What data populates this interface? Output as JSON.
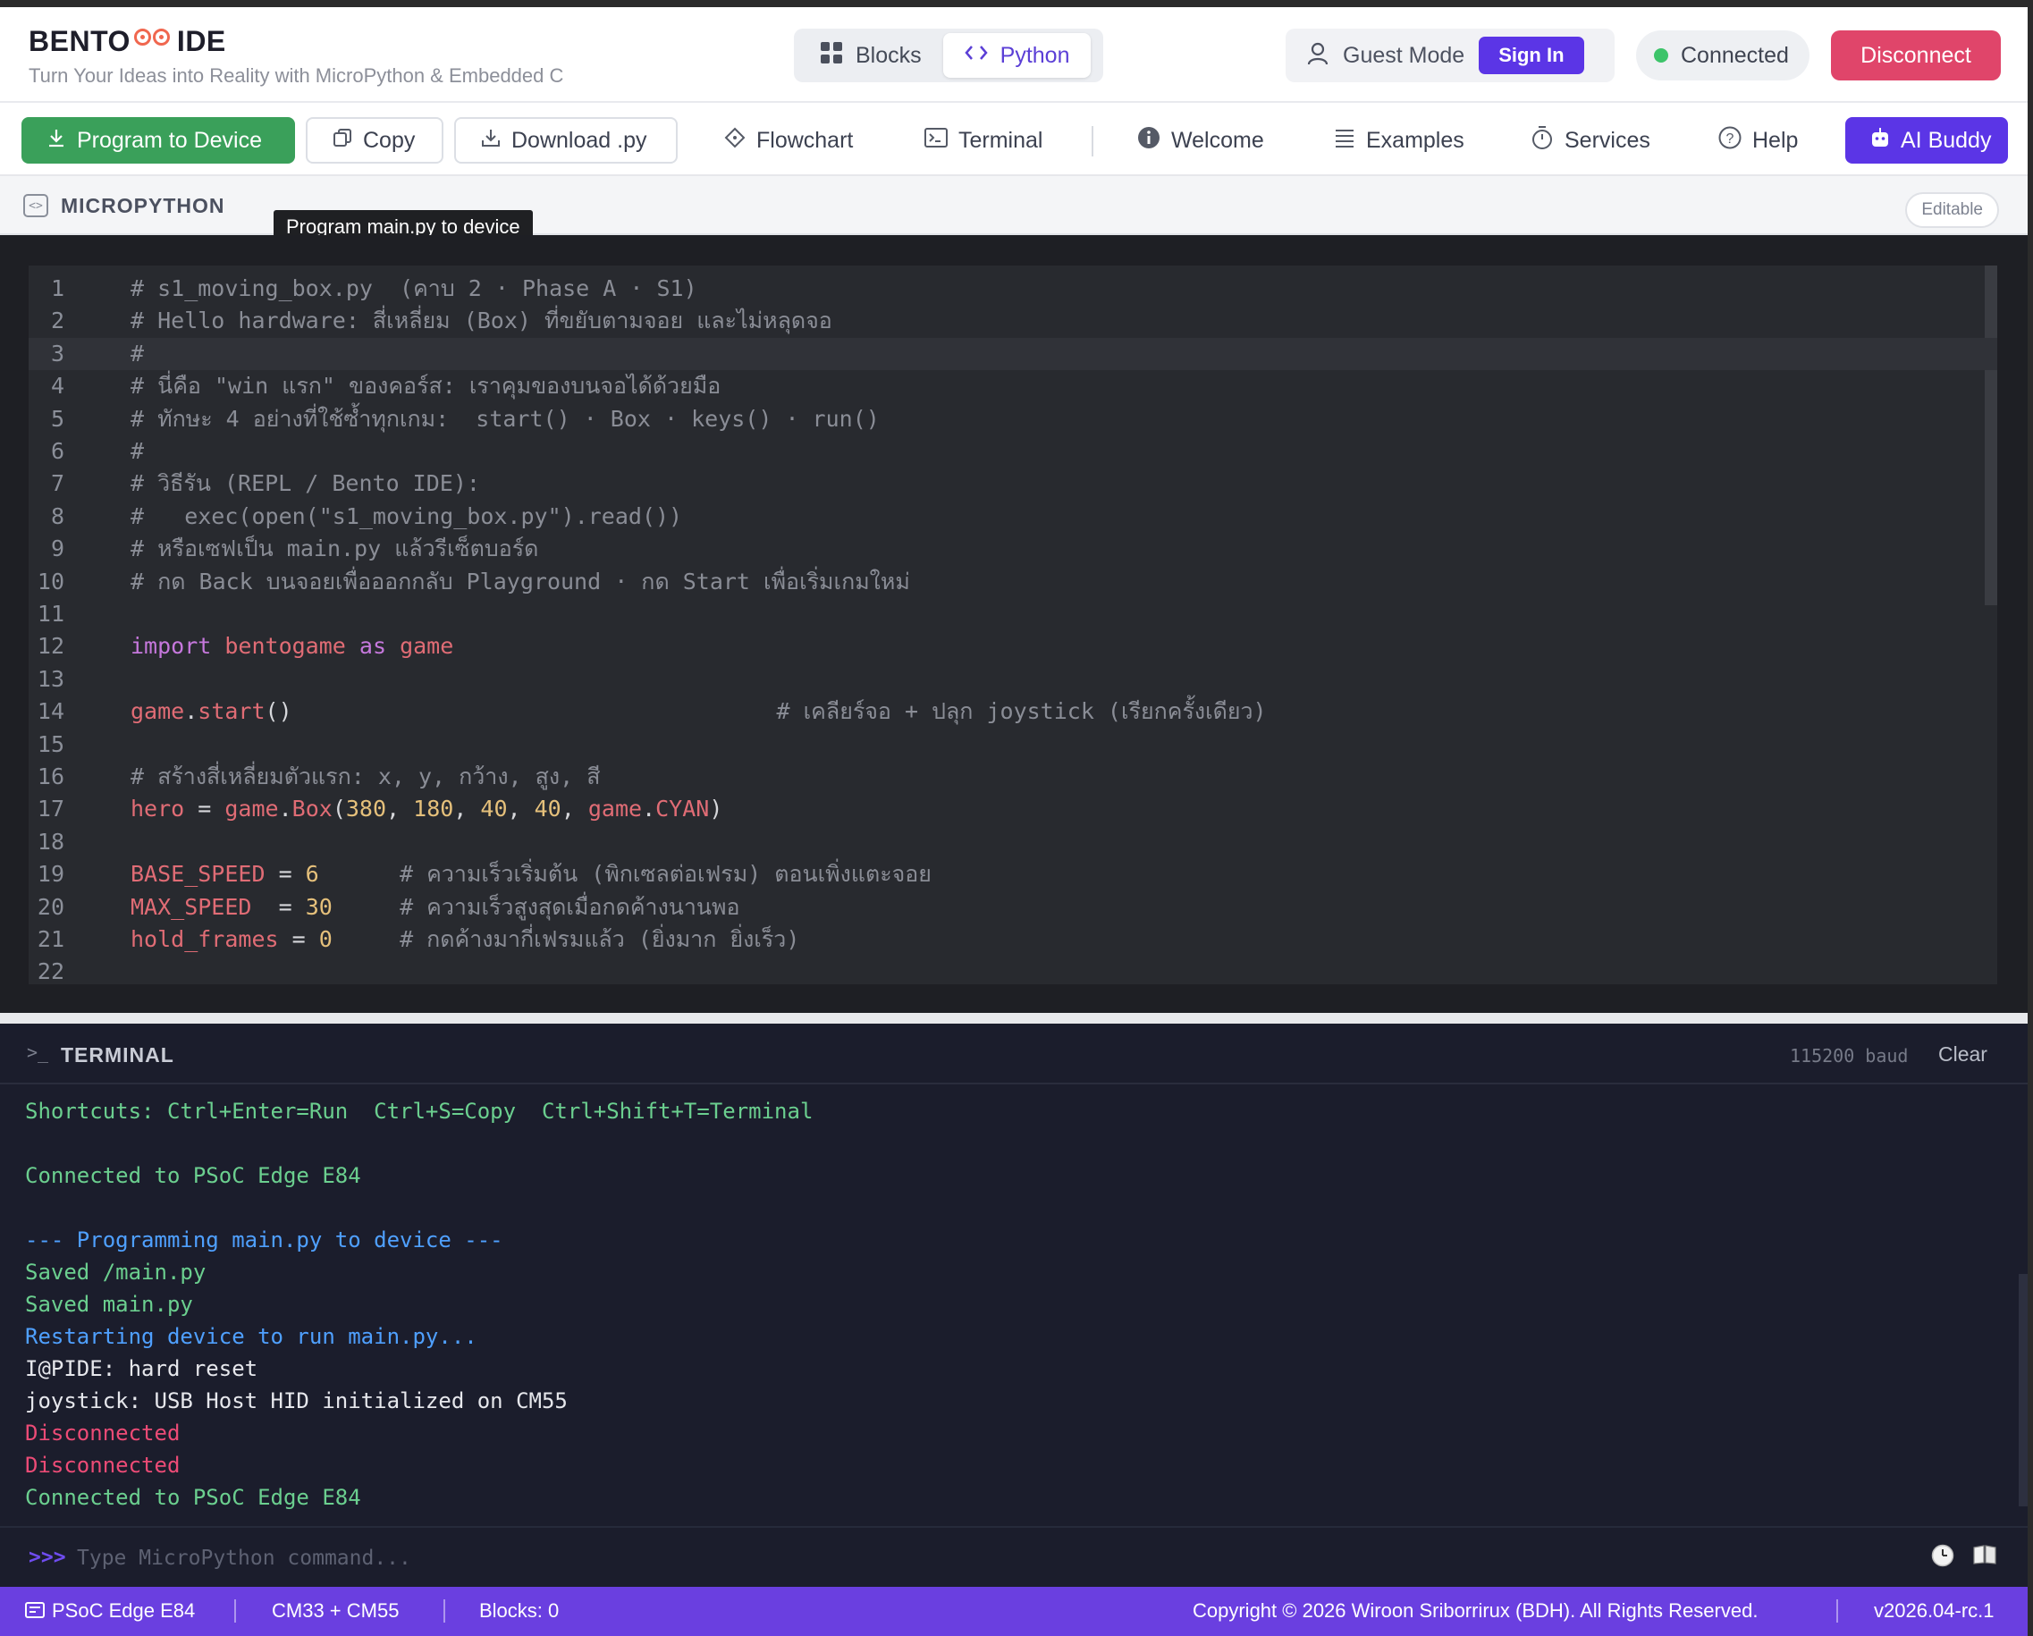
{
  "header": {
    "brand_title_a": "BENTO",
    "brand_title_b": "IDE",
    "brand_subtitle": "Turn Your Ideas into Reality with MicroPython & Embedded C",
    "mode_tabs": [
      {
        "label": "Blocks",
        "icon": "grid-icon"
      },
      {
        "label": "Python",
        "icon": "code-icon",
        "active": true
      }
    ],
    "guest_label": "Guest Mode",
    "signin_label": "Sign In",
    "connection_status": "Connected",
    "disconnect_label": "Disconnect",
    "colors": {
      "accent": "#5b35e6",
      "connected": "#3dc46a",
      "disconnect": "#e0456a",
      "program": "#3aa05a"
    }
  },
  "toolbar": {
    "program_label": "Program to Device",
    "copy_label": "Copy",
    "download_label": "Download .py",
    "flowchart_label": "Flowchart",
    "terminal_label": "Terminal",
    "welcome_label": "Welcome",
    "examples_label": "Examples",
    "services_label": "Services",
    "help_label": "Help",
    "ai_label": "AI Buddy"
  },
  "editor": {
    "title": "MICROPYTHON",
    "tooltip": "Program main.py to device",
    "editable_label": "Editable",
    "active_line": 3,
    "lines": [
      {
        "no": "1",
        "parts": [
          [
            "c",
            "# s1_moving_box.py  (คาบ 2 · Phase A · S1)"
          ]
        ]
      },
      {
        "no": "2",
        "parts": [
          [
            "c",
            "# Hello hardware: สี่เหลี่ยม (Box) ที่ขยับตามจอย และไม่หลุดจอ"
          ]
        ]
      },
      {
        "no": "3",
        "parts": [
          [
            "c",
            "#"
          ]
        ]
      },
      {
        "no": "4",
        "parts": [
          [
            "c",
            "# นี่คือ \"win แรก\" ของคอร์ส: เราคุมของบนจอได้ด้วยมือ"
          ]
        ]
      },
      {
        "no": "5",
        "parts": [
          [
            "c",
            "# ทักษะ 4 อย่างที่ใช้ซ้ำทุกเกม:  start() · Box · keys() · run()"
          ]
        ]
      },
      {
        "no": "6",
        "parts": [
          [
            "c",
            "#"
          ]
        ]
      },
      {
        "no": "7",
        "parts": [
          [
            "c",
            "# วิธีรัน (REPL / Bento IDE):"
          ]
        ]
      },
      {
        "no": "8",
        "parts": [
          [
            "c",
            "#   exec(open(\"s1_moving_box.py\").read())"
          ]
        ]
      },
      {
        "no": "9",
        "parts": [
          [
            "c",
            "# หรือเซฟเป็น main.py แล้วรีเซ็ตบอร์ด"
          ]
        ]
      },
      {
        "no": "10",
        "parts": [
          [
            "c",
            "# กด Back บนจอยเพื่อออกกลับ Playground · กด Start เพื่อเริ่มเกมใหม่"
          ]
        ]
      },
      {
        "no": "11",
        "parts": []
      },
      {
        "no": "12",
        "parts": [
          [
            "k",
            "import"
          ],
          [
            "p",
            " "
          ],
          [
            "v",
            "bentogame"
          ],
          [
            "p",
            " "
          ],
          [
            "k",
            "as"
          ],
          [
            "p",
            " "
          ],
          [
            "v",
            "game"
          ]
        ]
      },
      {
        "no": "13",
        "parts": []
      },
      {
        "no": "14",
        "parts": [
          [
            "v",
            "game"
          ],
          [
            "p",
            "."
          ],
          [
            "fn",
            "start"
          ],
          [
            "p",
            "()                                    "
          ],
          [
            "c",
            "# เคลียร์จอ + ปลุก joystick (เรียกครั้งเดียว)"
          ]
        ]
      },
      {
        "no": "15",
        "parts": []
      },
      {
        "no": "16",
        "parts": [
          [
            "c",
            "# สร้างสี่เหลี่ยมตัวแรก: x, y, กว้าง, สูง, สี"
          ]
        ]
      },
      {
        "no": "17",
        "parts": [
          [
            "v",
            "hero"
          ],
          [
            "p",
            " = "
          ],
          [
            "v",
            "game"
          ],
          [
            "p",
            "."
          ],
          [
            "fn",
            "Box"
          ],
          [
            "p",
            "("
          ],
          [
            "n",
            "380"
          ],
          [
            "p",
            ", "
          ],
          [
            "n",
            "180"
          ],
          [
            "p",
            ", "
          ],
          [
            "n",
            "40"
          ],
          [
            "p",
            ", "
          ],
          [
            "n",
            "40"
          ],
          [
            "p",
            ", "
          ],
          [
            "v",
            "game"
          ],
          [
            "p",
            "."
          ],
          [
            "v",
            "CYAN"
          ],
          [
            "p",
            ")"
          ]
        ]
      },
      {
        "no": "18",
        "parts": []
      },
      {
        "no": "19",
        "parts": [
          [
            "v",
            "BASE_SPEED"
          ],
          [
            "p",
            " = "
          ],
          [
            "n",
            "6"
          ],
          [
            "p",
            "      "
          ],
          [
            "c",
            "# ความเร็วเริ่มต้น (พิกเซลต่อเฟรม) ตอนเพิ่งแตะจอย"
          ]
        ]
      },
      {
        "no": "20",
        "parts": [
          [
            "v",
            "MAX_SPEED"
          ],
          [
            "p",
            "  = "
          ],
          [
            "n",
            "30"
          ],
          [
            "p",
            "     "
          ],
          [
            "c",
            "# ความเร็วสูงสุดเมื่อกดค้างนานพอ"
          ]
        ]
      },
      {
        "no": "21",
        "parts": [
          [
            "v",
            "hold_frames"
          ],
          [
            "p",
            " = "
          ],
          [
            "n",
            "0"
          ],
          [
            "p",
            "     "
          ],
          [
            "c",
            "# กดค้างมากี่เฟรมแล้ว (ยิ่งมาก ยิ่งเร็ว)"
          ]
        ]
      },
      {
        "no": "22",
        "parts": []
      }
    ]
  },
  "terminal": {
    "title": "TERMINAL",
    "baud": "115200 baud",
    "clear_label": "Clear",
    "lines": [
      {
        "cls": "g",
        "text": "Shortcuts: Ctrl+Enter=Run  Ctrl+S=Copy  Ctrl+Shift+T=Terminal"
      },
      {
        "cls": "g",
        "text": ""
      },
      {
        "cls": "g",
        "text": "Connected to PSoC Edge E84"
      },
      {
        "cls": "g",
        "text": ""
      },
      {
        "cls": "b",
        "text": "--- Programming main.py to device ---"
      },
      {
        "cls": "g",
        "text": "Saved /main.py"
      },
      {
        "cls": "g",
        "text": "Saved main.py"
      },
      {
        "cls": "b",
        "text": "Restarting device to run main.py..."
      },
      {
        "cls": "w",
        "text": "I@PIDE: hard reset"
      },
      {
        "cls": "w",
        "text": "joystick: USB Host HID initialized on CM55"
      },
      {
        "cls": "r",
        "text": "Disconnected"
      },
      {
        "cls": "r",
        "text": "Disconnected"
      },
      {
        "cls": "g",
        "text": "Connected to PSoC Edge E84"
      }
    ],
    "prompt_symbol": ">>>",
    "input_placeholder": "Type MicroPython command..."
  },
  "statusbar": {
    "board": "PSoC Edge E84",
    "cores": "CM33 + CM55",
    "blocks": "Blocks: 0",
    "copyright": "Copyright © 2026 Wiroon Sriborrirux (BDH). All Rights Reserved.",
    "version": "v2026.04-rc.1"
  }
}
